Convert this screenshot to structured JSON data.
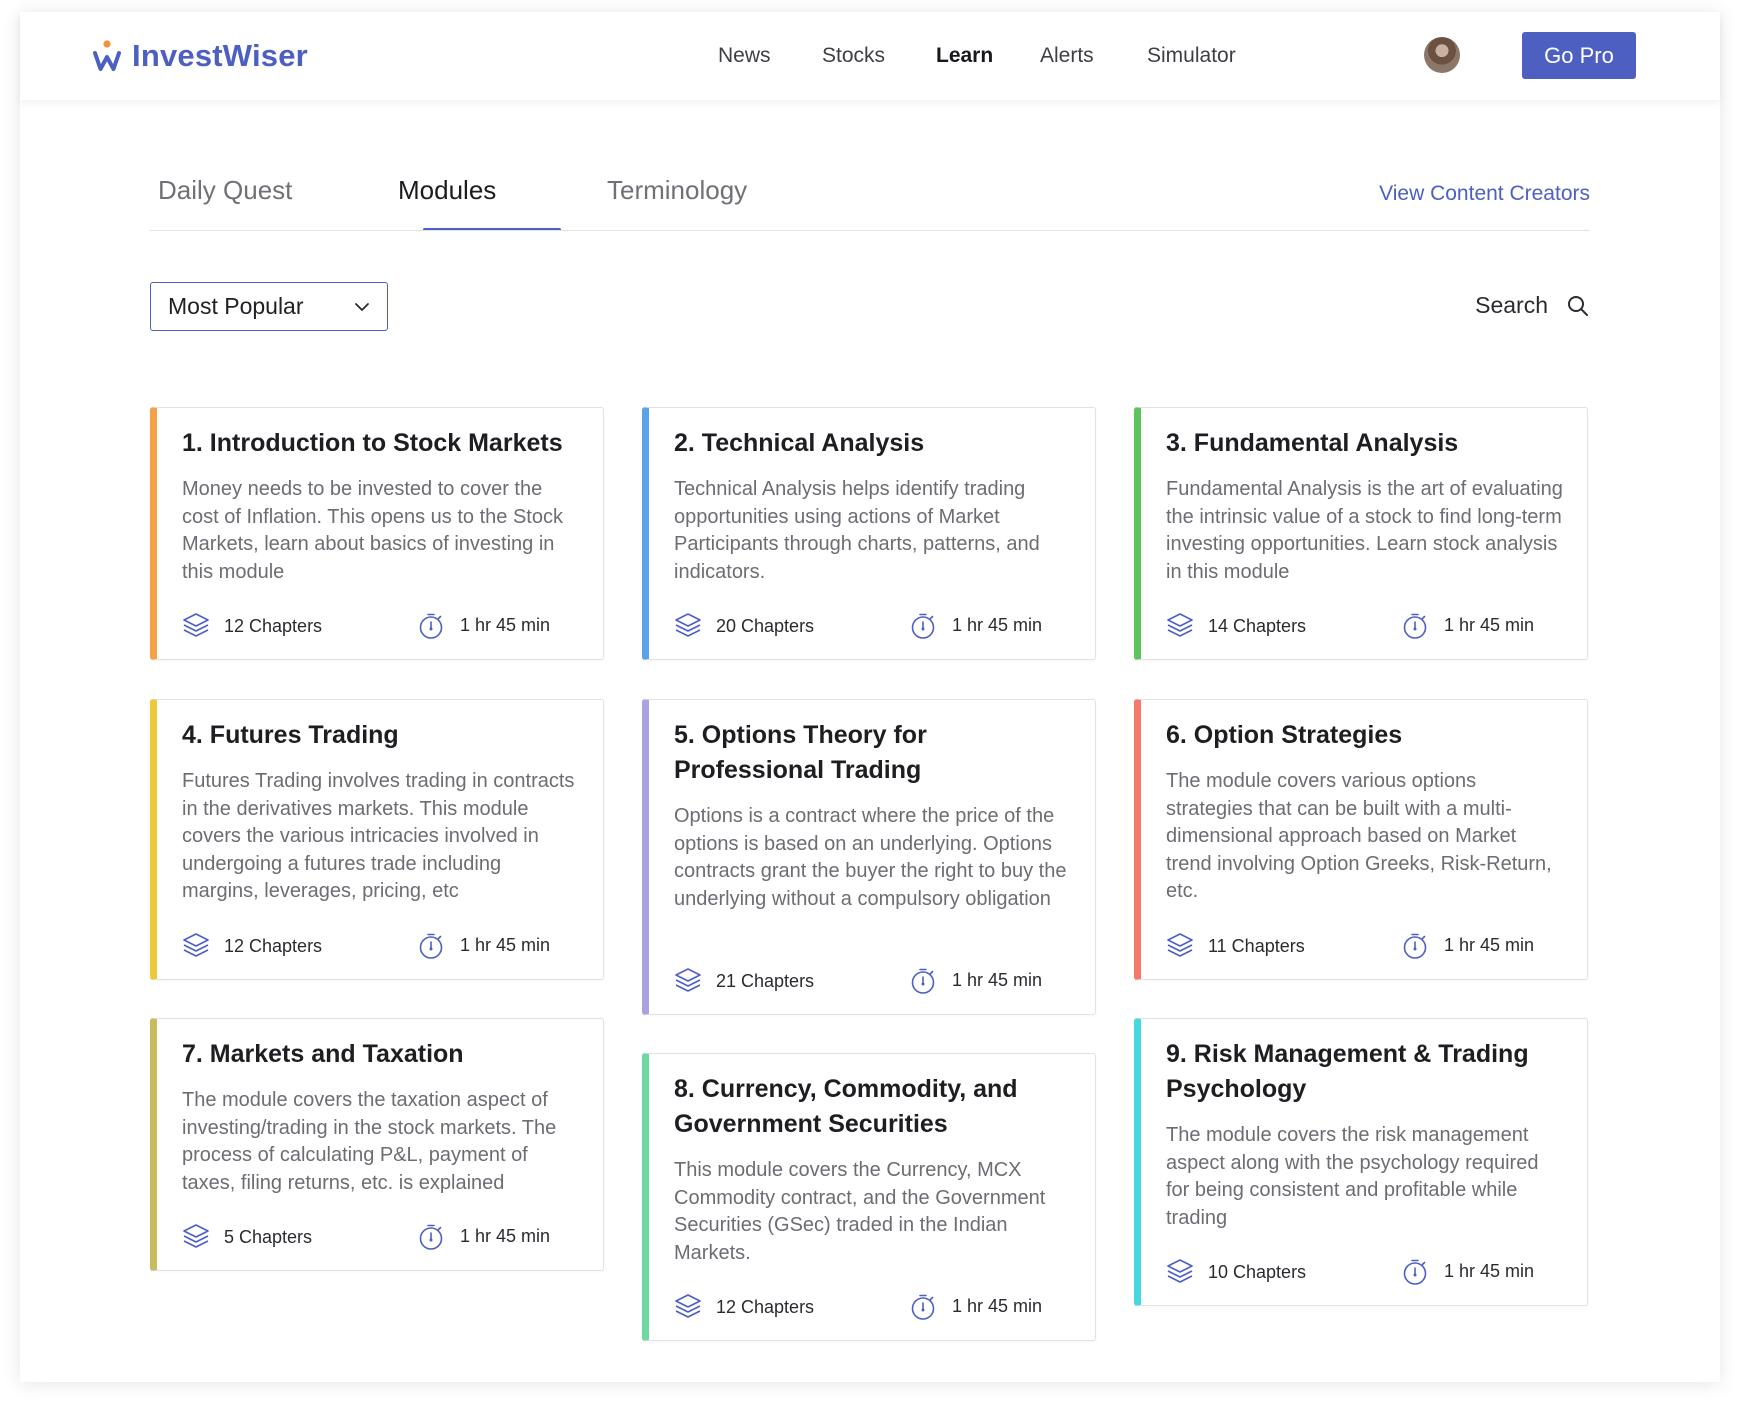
{
  "app": {
    "name": "InvestWiser",
    "colors": {
      "brand": "#4d5fc1"
    }
  },
  "header": {
    "nav": [
      "News",
      "Stocks",
      "Learn",
      "Alerts",
      "Simulator"
    ],
    "active_nav": "Learn",
    "cta_label": "Go Pro"
  },
  "tabs": {
    "items": [
      "Daily Quest",
      "Modules",
      "Terminology"
    ],
    "active": "Modules",
    "link_label": "View Content Creators"
  },
  "filter": {
    "selected": "Most Popular",
    "search_label": "Search"
  },
  "modules": [
    {
      "title": "1. Introduction to Stock Markets",
      "description": "Money needs to be invested to cover the cost of Inflation. This opens us to the Stock Markets, learn about basics of investing in this module",
      "chapters": "12 Chapters",
      "duration": "1 hr 45 min",
      "accent": "#f4a246"
    },
    {
      "title": "2. Technical Analysis",
      "description": "Technical Analysis helps identify trading opportunities using actions of Market Participants through charts, patterns, and indicators.",
      "chapters": "20 Chapters",
      "duration": "1 hr 45 min",
      "accent": "#5aa3ec"
    },
    {
      "title": "3. Fundamental Analysis",
      "description": "Fundamental Analysis is the art of evaluating the intrinsic value of a stock to find long-term investing opportunities. Learn stock analysis in this module",
      "chapters": "14 Chapters",
      "duration": "1 hr 45 min",
      "accent": "#5cc45e"
    },
    {
      "title": "4. Futures Trading",
      "description": "Futures Trading involves trading in contracts in the derivatives markets. This module covers the various intricacies involved in undergoing a futures trade including margins, leverages, pricing, etc",
      "chapters": "12 Chapters",
      "duration": "1 hr 45 min",
      "accent": "#ecc93a"
    },
    {
      "title": "5. Options Theory for Professional Trading",
      "description": "Options is a contract where the price of the options is based on an underlying. Options contracts grant the buyer the right to buy the underlying without a compulsory obligation",
      "chapters": "21 Chapters",
      "duration": "1 hr 45 min",
      "accent": "#a9a3e0"
    },
    {
      "title": "6. Option Strategies",
      "description": "The module covers various options strategies that can be built with a multi-dimensional approach based on Market trend involving Option Greeks, Risk-Return, etc.",
      "chapters": "11 Chapters",
      "duration": "1 hr 45 min",
      "accent": "#f27a6c"
    },
    {
      "title": "7. Markets and Taxation",
      "description": "The module covers the taxation aspect of investing/trading in the stock markets. The process of calculating P&L, payment of taxes, filing returns, etc. is explained",
      "chapters": "5 Chapters",
      "duration": "1 hr 45 min",
      "accent": "#c7bd5e"
    },
    {
      "title": "8. Currency, Commodity, and Government Securities",
      "description": "This module covers the Currency,  MCX Commodity contract, and the Government Securities (GSec) traded in the Indian Markets.",
      "chapters": "12 Chapters",
      "duration": "1 hr 45 min",
      "accent": "#6fd7a2"
    },
    {
      "title": "9. Risk Management & Trading Psychology",
      "description": "The module covers the risk management aspect along with the psychology required for being consistent and profitable while trading",
      "chapters": "10 Chapters",
      "duration": "1 hr 45 min",
      "accent": "#47d7e2"
    }
  ]
}
